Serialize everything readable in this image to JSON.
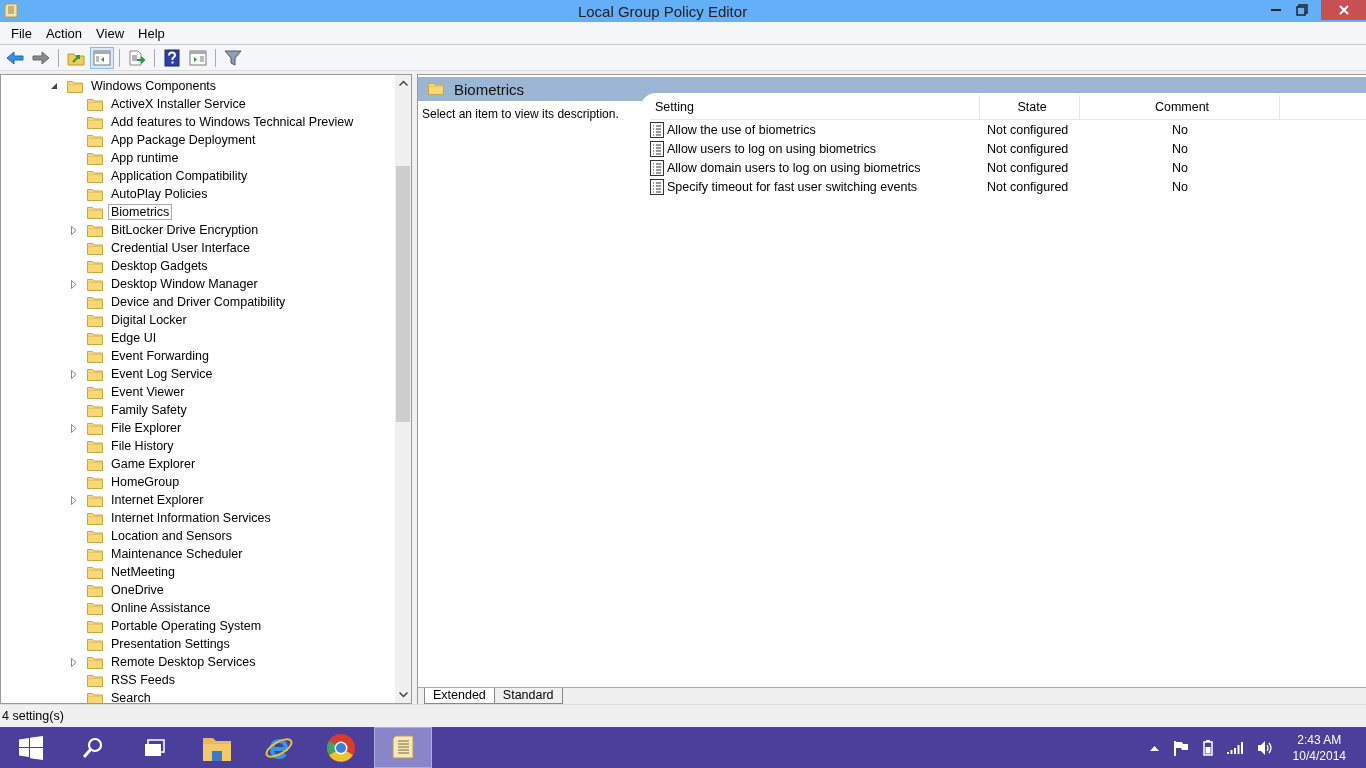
{
  "window": {
    "title": "Local Group Policy Editor"
  },
  "menu": [
    {
      "label": "File"
    },
    {
      "label": "Action"
    },
    {
      "label": "View"
    },
    {
      "label": "Help"
    }
  ],
  "toolbar": [
    {
      "kind": "back",
      "selected": false
    },
    {
      "kind": "forward",
      "selected": false
    },
    {
      "kind": "sep"
    },
    {
      "kind": "up",
      "selected": false
    },
    {
      "kind": "tree",
      "selected": true
    },
    {
      "kind": "sep"
    },
    {
      "kind": "export",
      "selected": false
    },
    {
      "kind": "sep"
    },
    {
      "kind": "help",
      "selected": false
    },
    {
      "kind": "pane",
      "selected": false
    },
    {
      "kind": "sep"
    },
    {
      "kind": "filter",
      "selected": false
    }
  ],
  "tree": [
    {
      "label": "Windows Components",
      "expanded": true,
      "selected": false,
      "children": [
        {
          "label": "ActiveX Installer Service",
          "selected": false
        },
        {
          "label": "Add features to Windows Technical Preview",
          "selected": false
        },
        {
          "label": "App Package Deployment",
          "selected": false
        },
        {
          "label": "App runtime",
          "selected": false
        },
        {
          "label": "Application Compatibility",
          "selected": false
        },
        {
          "label": "AutoPlay Policies",
          "selected": false
        },
        {
          "label": "Biometrics",
          "selected": true
        },
        {
          "label": "BitLocker Drive Encryption",
          "expanded": false,
          "selected": false
        },
        {
          "label": "Credential User Interface",
          "selected": false
        },
        {
          "label": "Desktop Gadgets",
          "selected": false
        },
        {
          "label": "Desktop Window Manager",
          "expanded": false,
          "selected": false
        },
        {
          "label": "Device and Driver Compatibility",
          "selected": false
        },
        {
          "label": "Digital Locker",
          "selected": false
        },
        {
          "label": "Edge UI",
          "selected": false
        },
        {
          "label": "Event Forwarding",
          "selected": false
        },
        {
          "label": "Event Log Service",
          "expanded": false,
          "selected": false
        },
        {
          "label": "Event Viewer",
          "selected": false
        },
        {
          "label": "Family Safety",
          "selected": false
        },
        {
          "label": "File Explorer",
          "expanded": false,
          "selected": false
        },
        {
          "label": "File History",
          "selected": false
        },
        {
          "label": "Game Explorer",
          "selected": false
        },
        {
          "label": "HomeGroup",
          "selected": false
        },
        {
          "label": "Internet Explorer",
          "expanded": false,
          "selected": false
        },
        {
          "label": "Internet Information Services",
          "selected": false
        },
        {
          "label": "Location and Sensors",
          "selected": false
        },
        {
          "label": "Maintenance Scheduler",
          "selected": false
        },
        {
          "label": "NetMeeting",
          "selected": false
        },
        {
          "label": "OneDrive",
          "selected": false
        },
        {
          "label": "Online Assistance",
          "selected": false
        },
        {
          "label": "Portable Operating System",
          "selected": false
        },
        {
          "label": "Presentation Settings",
          "selected": false
        },
        {
          "label": "Remote Desktop Services",
          "expanded": false,
          "selected": false
        },
        {
          "label": "RSS Feeds",
          "selected": false
        },
        {
          "label": "Search",
          "selected": false
        }
      ]
    }
  ],
  "details": {
    "heading": "Biometrics",
    "description": "Select an item to view its description.",
    "columns": [
      "Setting",
      "State",
      "Comment"
    ],
    "rows": [
      {
        "setting": "Allow the use of biometrics",
        "state": "Not configured",
        "comment": "No"
      },
      {
        "setting": "Allow users to log on using biometrics",
        "state": "Not configured",
        "comment": "No"
      },
      {
        "setting": "Allow domain users to log on using biometrics",
        "state": "Not configured",
        "comment": "No"
      },
      {
        "setting": "Specify timeout for fast user switching events",
        "state": "Not configured",
        "comment": "No"
      }
    ]
  },
  "view_tabs": [
    {
      "label": "Extended",
      "selected": true
    },
    {
      "label": "Standard",
      "selected": false
    }
  ],
  "status_bar": "4 setting(s)",
  "taskbar": {
    "apps": [
      {
        "kind": "start",
        "selected": false
      },
      {
        "kind": "search",
        "selected": false
      },
      {
        "kind": "taskview",
        "selected": false
      },
      {
        "kind": "explorer",
        "selected": false
      },
      {
        "kind": "ie",
        "selected": false
      },
      {
        "kind": "chrome",
        "selected": false
      },
      {
        "kind": "gpedit",
        "selected": true
      }
    ],
    "tray": [
      {
        "kind": "up"
      },
      {
        "kind": "flag"
      },
      {
        "kind": "battery"
      },
      {
        "kind": "signal"
      },
      {
        "kind": "volume"
      }
    ],
    "time": "2:43 AM",
    "date": "10/4/2014"
  }
}
